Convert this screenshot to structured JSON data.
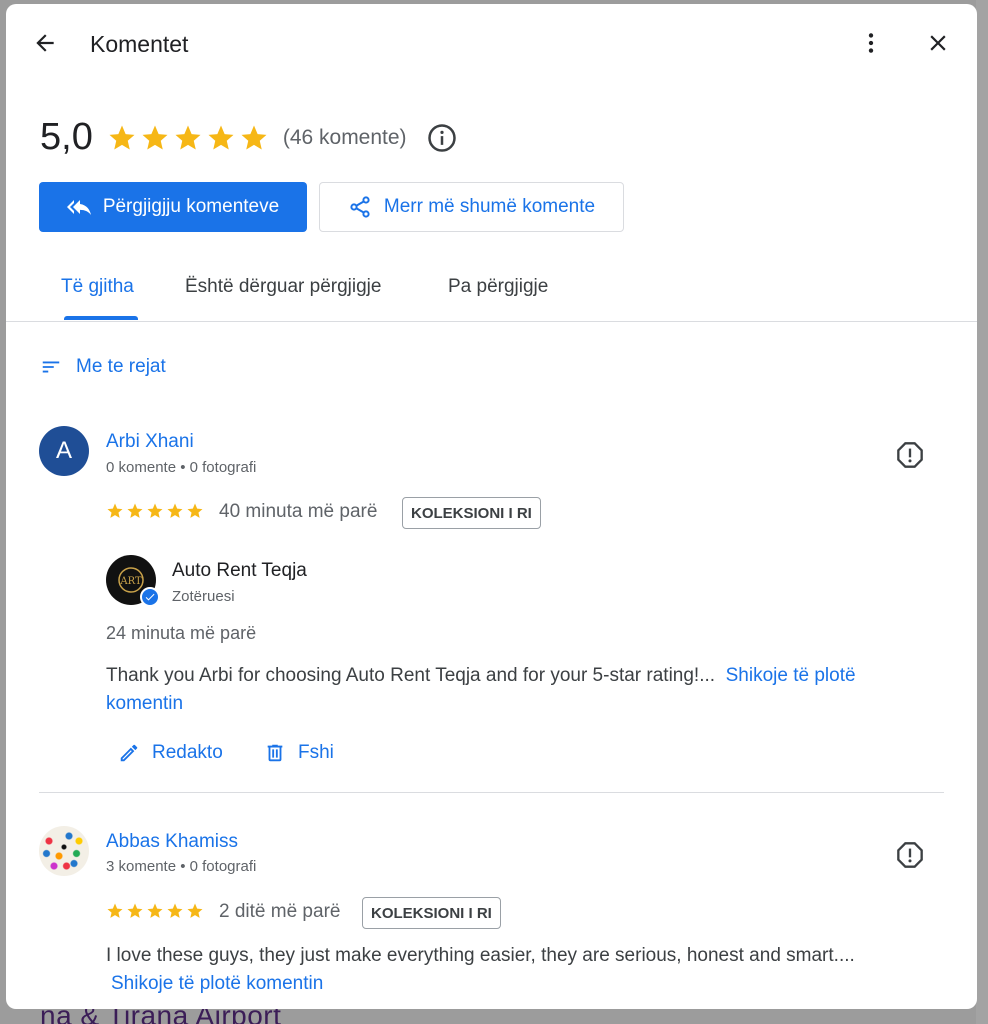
{
  "background": {
    "bottom_text": "na & Tirana Airport"
  },
  "dialog": {
    "title": "Komentet",
    "back_icon": "arrow-back-icon",
    "more_icon": "more-vert-icon",
    "close_icon": "close-icon"
  },
  "summary": {
    "rating": "5,0",
    "stars": 5,
    "count_text": "(46 komente)"
  },
  "actions": {
    "reply_label": "Përgjigjju komenteve",
    "more_reviews_label": "Merr më shumë komente"
  },
  "tabs": [
    {
      "label": "Të gjitha",
      "active": true
    },
    {
      "label": "Është dërguar përgjigje",
      "active": false
    },
    {
      "label": "Pa përgjigje",
      "active": false
    }
  ],
  "sort": {
    "label": "Me te rejat"
  },
  "reviews": [
    {
      "avatar_letter": "A",
      "name": "Arbi Xhani",
      "meta": "0 komente • 0 fotografi",
      "stars": 5,
      "time": "40 minuta më parë",
      "badge": "KOLEKSIONI I RI",
      "reply": {
        "owner_name": "Auto Rent Teqja",
        "owner_role": "Zotëruesi",
        "time": "24 minuta më parë",
        "text": "Thank you Arbi for choosing Auto Rent Teqja and for your 5-star rating!...",
        "more_link": "Shikoje të plotë komentin",
        "edit_label": "Redakto",
        "delete_label": "Fshi"
      }
    },
    {
      "name": "Abbas Khamiss",
      "meta": "3 komente • 0 fotografi",
      "stars": 5,
      "time": "2 ditë më parë",
      "badge": "KOLEKSIONI I RI",
      "text": "I love these guys, they just make everything easier, they are serious, honest and smart....",
      "more_link": "Shikoje të plotë komentin"
    }
  ],
  "colors": {
    "accent": "#1a73e8",
    "star": "#f6b716"
  }
}
